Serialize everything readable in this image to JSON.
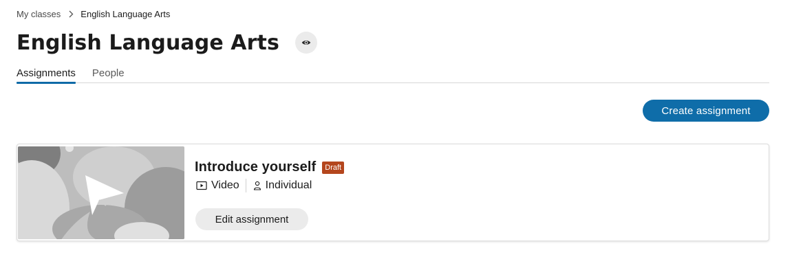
{
  "breadcrumb": {
    "root": "My classes",
    "current": "English Language Arts"
  },
  "header": {
    "title": "English Language Arts",
    "visibility_icon": "eye-icon"
  },
  "tabs": [
    {
      "label": "Assignments",
      "active": true
    },
    {
      "label": "People",
      "active": false
    }
  ],
  "actions": {
    "create_label": "Create assignment"
  },
  "assignments": [
    {
      "title": "Introduce yourself",
      "status": "Draft",
      "type_label": "Video",
      "type_icon": "video-icon",
      "group_label": "Individual",
      "group_icon": "person-icon",
      "edit_label": "Edit assignment"
    }
  ],
  "colors": {
    "accent": "#0f6da9",
    "draft_badge": "#b4461d",
    "secondary_button": "#ebebeb"
  }
}
